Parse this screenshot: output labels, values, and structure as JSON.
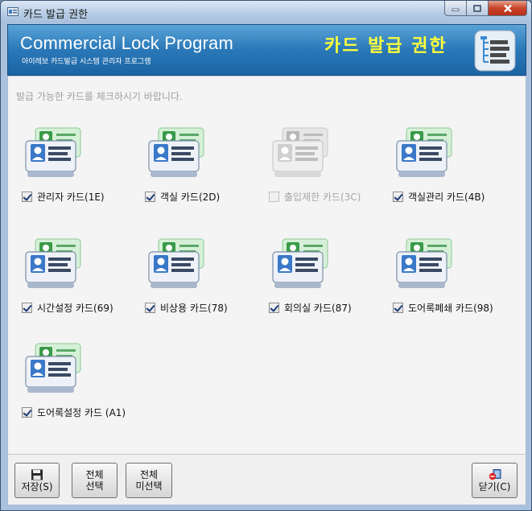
{
  "window": {
    "title": "카드 발급 권한"
  },
  "banner": {
    "title": "Commercial Lock Program",
    "subtitle": "아이레보 카드발급 시스템 관리자 프로그램",
    "right_title": "카드 발급 권한"
  },
  "instruction": "발급 가능한 카드를 체크하시기 바랍니다.",
  "cards": [
    {
      "label": "관리자 카드(1E)",
      "checked": true,
      "disabled": false
    },
    {
      "label": "객실 카드(2D)",
      "checked": true,
      "disabled": false
    },
    {
      "label": "출입제한 카드(3C)",
      "checked": false,
      "disabled": true
    },
    {
      "label": "객실관리 카드(4B)",
      "checked": true,
      "disabled": false
    },
    {
      "label": "시간설정 카드(69)",
      "checked": true,
      "disabled": false
    },
    {
      "label": "비상용 카드(78)",
      "checked": true,
      "disabled": false
    },
    {
      "label": "회의실 카드(87)",
      "checked": true,
      "disabled": false
    },
    {
      "label": "도어록폐쇄 카드(98)",
      "checked": true,
      "disabled": false
    },
    {
      "label": "도어록설정 카드 (A1)",
      "checked": true,
      "disabled": false
    }
  ],
  "buttons": {
    "save": "저장(S)",
    "select_all_line1": "전체",
    "select_all_line2": "선택",
    "deselect_all_line1": "전체",
    "deselect_all_line2": "미선택",
    "close": "닫기(C)"
  }
}
